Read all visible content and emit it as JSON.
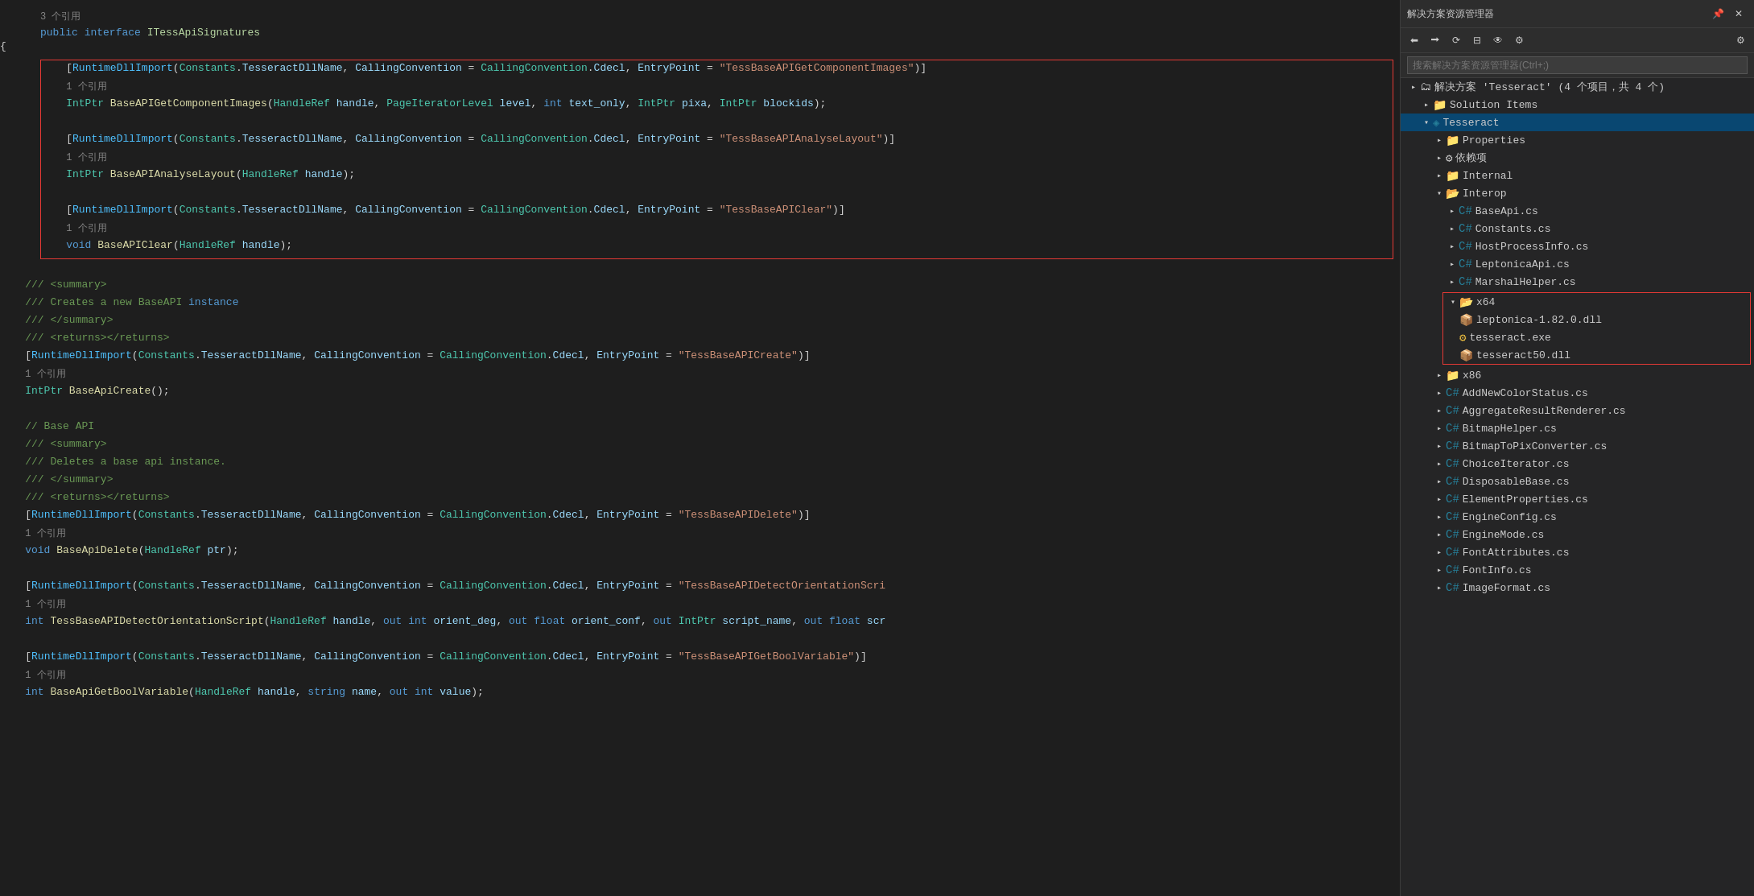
{
  "editor": {
    "topRef": "3 个引用",
    "topDecl": "public interface ITessApiSignatures",
    "lines": []
  },
  "solutionPanel": {
    "title": "解决方案资源管理器",
    "searchPlaceholder": "搜索解决方案资源管理器(Ctrl+;)",
    "solutionLabel": "解决方案 'Tesseract' (4 个项目，共 4 个)",
    "items": [
      {
        "label": "Solution Items",
        "type": "folder",
        "indent": 1,
        "expanded": false
      },
      {
        "label": "Tesseract",
        "type": "project",
        "indent": 1,
        "expanded": true
      },
      {
        "label": "Properties",
        "type": "folder",
        "indent": 2,
        "expanded": false
      },
      {
        "label": "依赖项",
        "type": "folder",
        "indent": 2,
        "expanded": false
      },
      {
        "label": "Internal",
        "type": "folder",
        "indent": 2,
        "expanded": false
      },
      {
        "label": "Interop",
        "type": "folder",
        "indent": 2,
        "expanded": true
      },
      {
        "label": "BaseApi.cs",
        "type": "cs",
        "indent": 3
      },
      {
        "label": "Constants.cs",
        "type": "cs",
        "indent": 3
      },
      {
        "label": "HostProcessInfo.cs",
        "type": "cs",
        "indent": 3
      },
      {
        "label": "LeptonicaApi.cs",
        "type": "cs",
        "indent": 3
      },
      {
        "label": "MarshalHelper.cs",
        "type": "cs",
        "indent": 3
      },
      {
        "label": "x64",
        "type": "folder",
        "indent": 2,
        "expanded": true,
        "highlighted": true
      },
      {
        "label": "leptonica-1.82.0.dll",
        "type": "dll",
        "indent": 3,
        "highlighted": true
      },
      {
        "label": "tesseract.exe",
        "type": "exe",
        "indent": 3,
        "highlighted": true
      },
      {
        "label": "tesseract50.dll",
        "type": "dll",
        "indent": 3,
        "highlighted": true
      },
      {
        "label": "x86",
        "type": "folder",
        "indent": 2,
        "expanded": false
      },
      {
        "label": "AddNewColorStatus.cs",
        "type": "cs",
        "indent": 2
      },
      {
        "label": "AggregateResultRenderer.cs",
        "type": "cs",
        "indent": 2
      },
      {
        "label": "BitmapHelper.cs",
        "type": "cs",
        "indent": 2
      },
      {
        "label": "BitmapToPixConverter.cs",
        "type": "cs",
        "indent": 2
      },
      {
        "label": "ChoiceIterator.cs",
        "type": "cs",
        "indent": 2
      },
      {
        "label": "DisposableBase.cs",
        "type": "cs",
        "indent": 2
      },
      {
        "label": "ElementProperties.cs",
        "type": "cs",
        "indent": 2
      },
      {
        "label": "EngineConfig.cs",
        "type": "cs",
        "indent": 2
      },
      {
        "label": "EngineMode.cs",
        "type": "cs",
        "indent": 2
      },
      {
        "label": "FontAttributes.cs",
        "type": "cs",
        "indent": 2
      },
      {
        "label": "FontInfo.cs",
        "type": "cs",
        "indent": 2
      },
      {
        "label": "ImageFormat.cs",
        "type": "cs",
        "indent": 2
      }
    ]
  }
}
